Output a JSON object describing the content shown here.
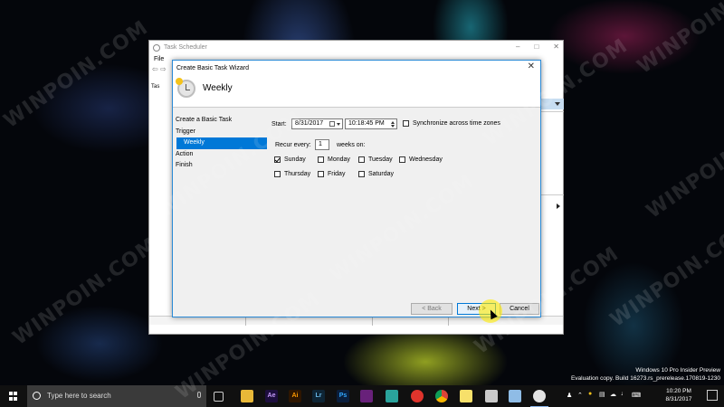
{
  "watermark": "WINPOIN.COM",
  "task_scheduler": {
    "title": "Task Scheduler",
    "menu_file": "File",
    "tree_item": "Tas"
  },
  "wizard": {
    "title": "Create Basic Task Wizard",
    "header_title": "Weekly",
    "steps": [
      {
        "label": "Create a Basic Task",
        "active": false
      },
      {
        "label": "Trigger",
        "active": false
      },
      {
        "label": "Weekly",
        "active": true
      },
      {
        "label": "Action",
        "active": false
      },
      {
        "label": "Finish",
        "active": false
      }
    ],
    "start_label": "Start:",
    "start_date": "8/31/2017",
    "start_time": "10:18:45 PM",
    "sync_label": "Synchronize across time zones",
    "sync_checked": false,
    "recur_label": "Recur every:",
    "recur_value": "1",
    "weeks_on_label": "weeks on:",
    "days": [
      {
        "label": "Sunday",
        "checked": true
      },
      {
        "label": "Monday",
        "checked": false
      },
      {
        "label": "Tuesday",
        "checked": false
      },
      {
        "label": "Wednesday",
        "checked": false
      },
      {
        "label": "Thursday",
        "checked": false
      },
      {
        "label": "Friday",
        "checked": false
      },
      {
        "label": "Saturday",
        "checked": false
      }
    ],
    "buttons": {
      "back": "< Back",
      "next": "Next >",
      "cancel": "Cancel"
    }
  },
  "taskbar": {
    "search_placeholder": "Type here to search",
    "apps": [
      {
        "icon": "task-view-icon",
        "label": ""
      },
      {
        "icon": "file-explorer-icon",
        "label": ""
      },
      {
        "icon": "after-effects-icon",
        "label": "Ae"
      },
      {
        "icon": "illustrator-icon",
        "label": "Ai"
      },
      {
        "icon": "lightroom-icon",
        "label": "Lr"
      },
      {
        "icon": "photoshop-icon",
        "label": "Ps"
      },
      {
        "icon": "visual-studio-icon",
        "label": ""
      },
      {
        "icon": "greenshot-icon",
        "label": ""
      },
      {
        "icon": "opera-icon",
        "label": ""
      },
      {
        "icon": "chrome-icon",
        "label": ""
      },
      {
        "icon": "sticky-notes-icon",
        "label": ""
      },
      {
        "icon": "printer-icon",
        "label": ""
      },
      {
        "icon": "notepad-icon",
        "label": ""
      },
      {
        "icon": "task-scheduler-icon",
        "label": ""
      }
    ],
    "clock_time": "10:20 PM",
    "clock_date": "8/31/2017"
  },
  "desktop_overlay": {
    "line1": "Windows 10 Pro Insider Preview",
    "line2": "Evaluation copy. Build 16273.rs_prerelease.170819-1230"
  },
  "colors": {
    "accent": "#0078d7",
    "taskbar": "#101010",
    "dialog_bg": "#f0f0f0"
  }
}
